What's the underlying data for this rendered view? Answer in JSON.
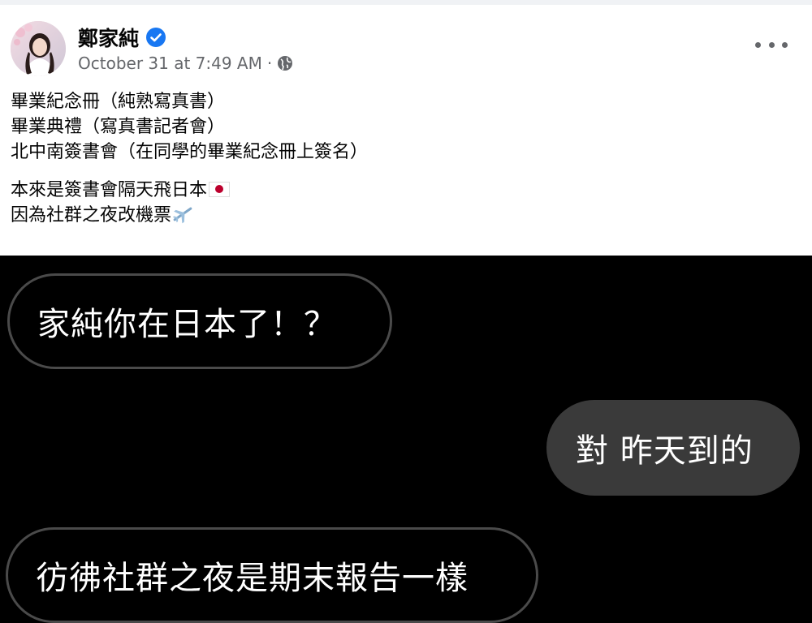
{
  "post": {
    "author": "鄭家純",
    "timestamp": "October 31 at 7:49 AM",
    "separator": "·",
    "privacy_icon": "globe-icon",
    "verified_icon": "verified-badge-icon",
    "more_icon": "more-options-icon",
    "lines": [
      "畢業紀念冊（純熟寫真書）",
      "畢業典禮（寫真書記者會）",
      "北中南簽書會（在同學的畢業紀念冊上簽名）"
    ],
    "line4": "本來是簽書會隔天飛日本",
    "line4_icon": "japan-flag-icon",
    "line5": "因為社群之夜改機票",
    "line5_icon": "airplane-icon",
    "colors": {
      "text": "#050505",
      "meta": "#65676b",
      "verified": "#1877f2"
    }
  },
  "chat": {
    "messages": [
      {
        "sender": "other",
        "text": "家純你在日本了！？"
      },
      {
        "sender": "me",
        "text": "對 昨天到的"
      },
      {
        "sender": "other",
        "text": "彷彿社群之夜是期末報告一樣"
      }
    ],
    "colors": {
      "background": "#000000",
      "outgoing_bubble": "#3a3a3a",
      "incoming_border": "#4a4a4a"
    }
  }
}
